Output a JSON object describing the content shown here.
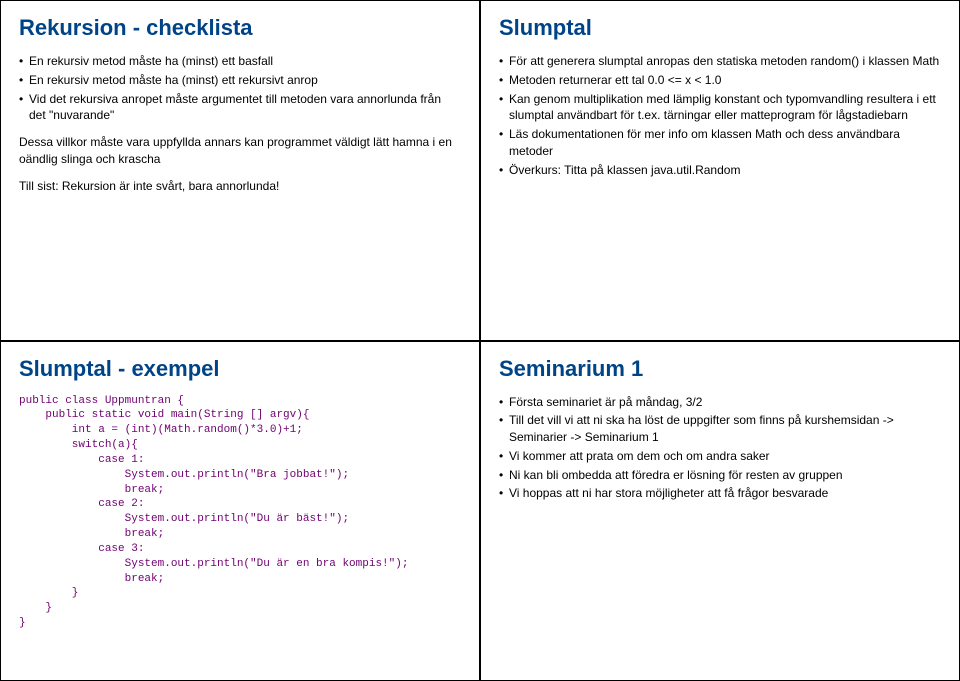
{
  "slides": {
    "topLeft": {
      "title": "Rekursion - checklista",
      "bullets": [
        "En rekursiv metod måste ha (minst) ett basfall",
        "En rekursiv metod måste ha (minst) ett rekursivt anrop",
        "Vid det rekursiva anropet måste argumentet till metoden vara annorlunda från det \"nuvarande\""
      ],
      "para1": "Dessa villkor måste vara uppfyllda annars kan programmet väldigt lätt hamna i en oändlig slinga och krascha",
      "para2": "Till sist: Rekursion är inte svårt, bara annorlunda!"
    },
    "topRight": {
      "title": "Slumptal",
      "bullets": [
        "För att generera slumptal anropas den statiska metoden random() i klassen Math",
        "Metoden returnerar ett tal 0.0 <= x < 1.0",
        "Kan genom multiplikation med lämplig konstant och typomvandling resultera i ett slumptal användbart för t.ex. tärningar eller matteprogram för lågstadiebarn",
        "Läs dokumentationen för mer info om klassen Math och dess användbara metoder",
        "Överkurs: Titta på klassen java.util.Random"
      ]
    },
    "bottomLeft": {
      "title": "Slumptal - exempel",
      "code": "public class Uppmuntran {\n    public static void main(String [] argv){\n        int a = (int)(Math.random()*3.0)+1;\n        switch(a){\n            case 1:\n                System.out.println(\"Bra jobbat!\");\n                break;\n            case 2:\n                System.out.println(\"Du är bäst!\");\n                break;\n            case 3:\n                System.out.println(\"Du är en bra kompis!\");\n                break;\n        }\n    }\n}"
    },
    "bottomRight": {
      "title": "Seminarium 1",
      "bullets": [
        "Första seminariet är på måndag, 3/2",
        "Till det vill vi att ni ska ha löst de uppgifter som finns på kurshemsidan -> Seminarier -> Seminarium 1",
        "Vi kommer att prata om dem och om andra saker",
        "Ni kan bli ombedda att föredra er lösning för resten av gruppen",
        "Vi hoppas att ni har stora möjligheter att få frågor besvarade"
      ]
    }
  }
}
